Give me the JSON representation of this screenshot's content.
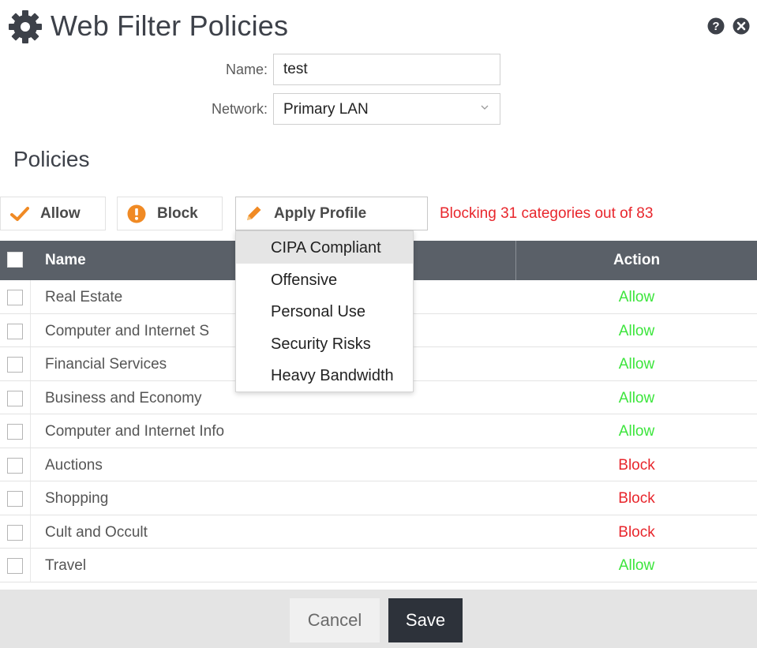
{
  "header": {
    "title": "Web Filter Policies",
    "icons": {
      "left": "gear-icon",
      "help": "help-icon",
      "close": "close-icon"
    }
  },
  "form": {
    "name_label": "Name:",
    "name_value": "test",
    "network_label": "Network:",
    "network_value": "Primary LAN"
  },
  "section_title": "Policies",
  "toolbar": {
    "allow_label": "Allow",
    "block_label": "Block",
    "profile_label": "Apply Profile",
    "blocking_message": "Blocking 31 categories out of 83"
  },
  "profile_menu": {
    "items": [
      "CIPA Compliant",
      "Offensive",
      "Personal Use",
      "Security Risks",
      "Heavy Bandwidth"
    ],
    "highlighted": "CIPA Compliant"
  },
  "table": {
    "columns": {
      "name": "Name",
      "action": "Action"
    },
    "rows": [
      {
        "name": "Real Estate",
        "action": "Allow"
      },
      {
        "name": "Computer and Internet S",
        "action": "Allow"
      },
      {
        "name": "Financial Services",
        "action": "Allow"
      },
      {
        "name": "Business and Economy",
        "action": "Allow"
      },
      {
        "name": "Computer and Internet Info",
        "action": "Allow"
      },
      {
        "name": "Auctions",
        "action": "Block"
      },
      {
        "name": "Shopping",
        "action": "Block"
      },
      {
        "name": "Cult and Occult",
        "action": "Block"
      },
      {
        "name": "Travel",
        "action": "Allow"
      }
    ]
  },
  "footer": {
    "cancel_label": "Cancel",
    "save_label": "Save"
  },
  "colors": {
    "allow": "#3ce53c",
    "block": "#e8262c",
    "header_bg": "#5a6068",
    "save_bg": "#2d323a",
    "profile_icon": "#f08a24"
  }
}
